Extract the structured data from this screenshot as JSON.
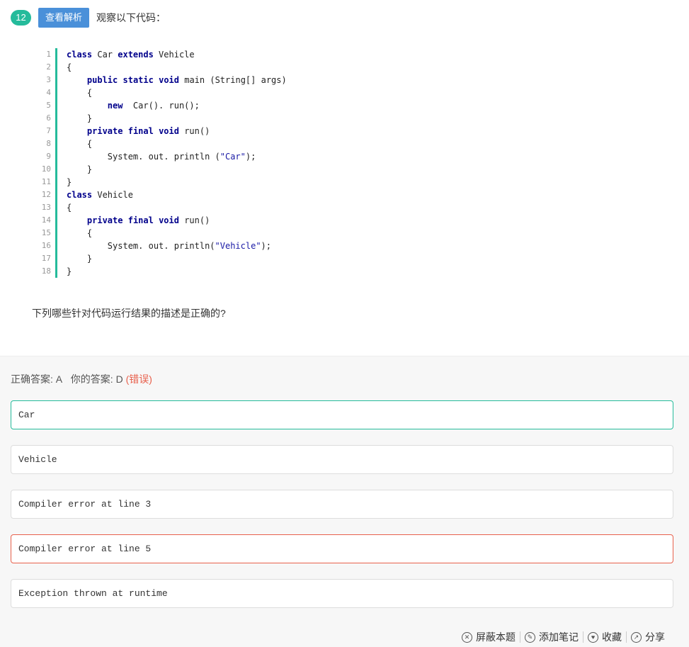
{
  "question": {
    "number": "12",
    "view_button": "查看解析",
    "title": "观察以下代码：",
    "description": "下列哪些针对代码运行结果的描述是正确的?"
  },
  "code_lines": [
    {
      "n": "1",
      "t": "class Car extends Vehicle"
    },
    {
      "n": "2",
      "t": "{"
    },
    {
      "n": "3",
      "t": "    public static void main (String[] args)"
    },
    {
      "n": "4",
      "t": "    {"
    },
    {
      "n": "5",
      "t": "        new  Car(). run();"
    },
    {
      "n": "6",
      "t": "    }"
    },
    {
      "n": "7",
      "t": "    private final void run()"
    },
    {
      "n": "8",
      "t": "    {"
    },
    {
      "n": "9",
      "t": "        System. out. println (\"Car\");"
    },
    {
      "n": "10",
      "t": "    }"
    },
    {
      "n": "11",
      "t": "}"
    },
    {
      "n": "12",
      "t": "class Vehicle"
    },
    {
      "n": "13",
      "t": "{"
    },
    {
      "n": "14",
      "t": "    private final void run()"
    },
    {
      "n": "15",
      "t": "    {"
    },
    {
      "n": "16",
      "t": "        System. out. println(\"Vehicle\");"
    },
    {
      "n": "17",
      "t": "    }"
    },
    {
      "n": "18",
      "t": "}"
    }
  ],
  "answer": {
    "correct_label": "正确答案: A",
    "yours_label": "你的答案: D",
    "wrong_tag": "(错误)"
  },
  "options": [
    {
      "text": "Car",
      "state": "correct"
    },
    {
      "text": "Vehicle",
      "state": "normal"
    },
    {
      "text": "Compiler error at line 3",
      "state": "normal"
    },
    {
      "text": "Compiler error at line 5",
      "state": "wrong"
    },
    {
      "text": "Exception thrown at runtime",
      "state": "normal"
    }
  ],
  "footer": {
    "block": "屏蔽本题",
    "note": "添加笔记",
    "collect": "收藏",
    "share": "分享"
  },
  "colors": {
    "accent": "#25bb9b",
    "button": "#4a90d9",
    "wrong": "#e8604c"
  }
}
